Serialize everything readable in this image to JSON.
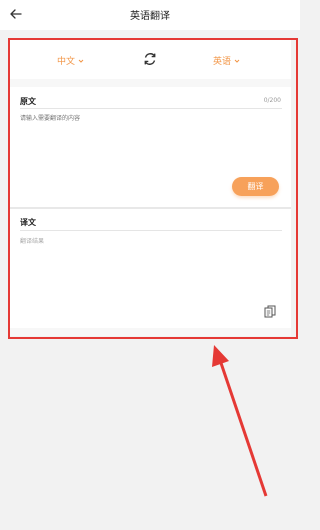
{
  "header": {
    "title": "英语翻译",
    "back_icon": "arrow-left-icon"
  },
  "languages": {
    "source": "中文",
    "target": "英语",
    "swap_icon": "refresh-icon"
  },
  "source": {
    "label": "原文",
    "counter": "0/200",
    "placeholder": "请输入需要翻译的内容"
  },
  "actions": {
    "translate_label": "翻译"
  },
  "result": {
    "label": "译文",
    "placeholder": "翻译结果",
    "copy_icon": "copy-icon"
  },
  "colors": {
    "accent": "#f29545",
    "button": "#f7a15a",
    "annotation": "#e53935"
  }
}
